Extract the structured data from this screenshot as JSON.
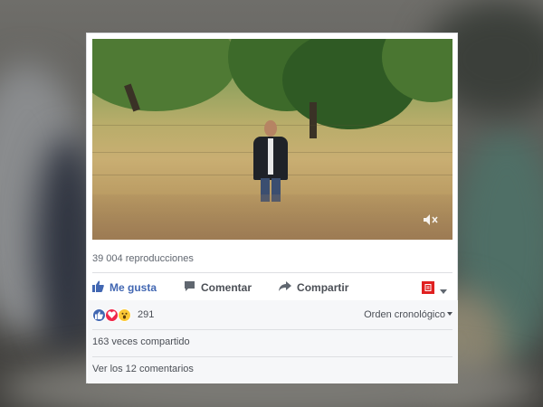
{
  "post": {
    "views": "39 004 reproducciones",
    "actions": {
      "like_label": "Me gusta",
      "comment_label": "Comentar",
      "share_label": "Compartir"
    },
    "reactions": {
      "types": [
        "like-icon",
        "love-icon",
        "wow-icon"
      ],
      "count": "291"
    },
    "order_label": "Orden cronológico",
    "shares_text": "163 veces compartido",
    "comments_link": "Ver los 12 comentarios"
  },
  "colors": {
    "accent": "#4267b2",
    "love": "#f0284a",
    "wow": "#fcc936",
    "toggle_red": "#e02020"
  },
  "icons": {
    "video": "mute-icon",
    "like": "thumbs-up-icon",
    "comment": "comment-bubble-icon",
    "share": "share-arrow-icon",
    "viewer": "viewer-select-icon"
  }
}
